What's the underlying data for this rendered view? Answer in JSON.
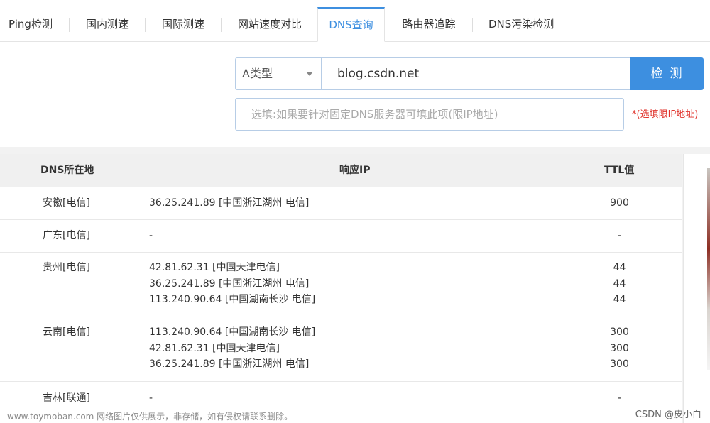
{
  "tabs": [
    {
      "label": "Ping检测"
    },
    {
      "label": "国内测速"
    },
    {
      "label": "国际测速"
    },
    {
      "label": "网站速度对比"
    },
    {
      "label": "DNS查询"
    },
    {
      "label": "路由器追踪"
    },
    {
      "label": "DNS污染检测"
    }
  ],
  "active_tab": "DNS查询",
  "query": {
    "type_select": "A类型",
    "domain_value": "blog.csdn.net",
    "check_button": "检测",
    "dns_server_placeholder": "选填:如果要针对固定DNS服务器可填此项(限IP地址)",
    "hint": "*(选填限IP地址)"
  },
  "table": {
    "headers": {
      "location": "DNS所在地",
      "ip": "响应IP",
      "ttl": "TTL值"
    },
    "rows": [
      {
        "location": "安徽[电信]",
        "ips": [
          "36.25.241.89 [中国浙江湖州 电信]"
        ],
        "ttls": [
          "900"
        ]
      },
      {
        "location": "广东[电信]",
        "ips": [
          "-"
        ],
        "ttls": [
          "-"
        ]
      },
      {
        "location": "贵州[电信]",
        "ips": [
          "42.81.62.31 [中国天津电信]",
          "36.25.241.89 [中国浙江湖州 电信]",
          "113.240.90.64 [中国湖南长沙 电信]"
        ],
        "ttls": [
          "44",
          "44",
          "44"
        ]
      },
      {
        "location": "云南[电信]",
        "ips": [
          "113.240.90.64 [中国湖南长沙 电信]",
          "42.81.62.31 [中国天津电信]",
          "36.25.241.89 [中国浙江湖州 电信]"
        ],
        "ttls": [
          "300",
          "300",
          "300"
        ]
      },
      {
        "location": "吉林[联通]",
        "ips": [
          "-"
        ],
        "ttls": [
          "-"
        ]
      }
    ]
  },
  "footer": {
    "watermark": "www.toymoban.com 网络图片仅供展示，非存储，如有侵权请联系删除。",
    "credit": "CSDN @皮小白"
  },
  "colors": {
    "accent": "#3d8fe0",
    "hint": "#e0312a"
  }
}
